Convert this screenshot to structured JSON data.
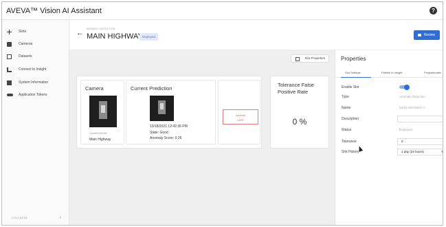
{
  "app": {
    "title": "AVEVA™ Vision AI Assistant",
    "help_icon": "?"
  },
  "sidebar": {
    "items": [
      {
        "label": "Slots",
        "icon": "plus-icon"
      },
      {
        "label": "Cameras",
        "icon": "camera-icon"
      },
      {
        "label": "Datasets",
        "icon": "dataset-icon"
      },
      {
        "label": "Connect to Insight",
        "icon": "connect-icon"
      },
      {
        "label": "System Information",
        "icon": "info-icon"
      },
      {
        "label": "Application Tokens",
        "icon": "key-icon"
      }
    ],
    "collapse_label": "COLLAPSE",
    "collapse_chevron": "‹"
  },
  "header": {
    "breadcrumb": "ANOMALY DETECTION",
    "title": "MAIN HIGHWAY V",
    "status": "Deployed",
    "review_label": "Review"
  },
  "content": {
    "slot_properties_label": "Slot Properties",
    "camera_card": {
      "title": "Camera",
      "sub_label": "CAMERA NAME",
      "name": "Main Highway"
    },
    "prediction_card": {
      "title": "Current Prediction",
      "timestamp": "10/18/2021 12:42:35 PM",
      "state": "State: Good",
      "score": "Anomaly Score: 0.26"
    },
    "drop_zone": {
      "line1": "Anomal",
      "line2": "LATE"
    },
    "tolerance_card": {
      "title": "Tolerance False Positive Rate",
      "value": "0 %"
    }
  },
  "properties": {
    "title": "Properties",
    "tabs": [
      "Slot Settings",
      "Publish to Insight",
      "Programmatic"
    ],
    "active_tab": 0,
    "fields": {
      "enable_slot_label": "Enable Slot",
      "enable_slot_on": true,
      "type_label": "Type",
      "type_value": "Anomaly Detection",
      "name_label": "Name",
      "name_value": "MAIN HIGHWAY V",
      "description_label": "Description",
      "description_value": "",
      "status_label": "Status",
      "status_value": "Deployed",
      "tolerance_label": "Tolerance",
      "tolerance_value": "0",
      "slot_history_label": "Slot History",
      "slot_history_value": "1 day (24 hours)"
    }
  },
  "colors": {
    "accent": "#2f6fd4",
    "badge_bg": "#e3e9f6",
    "alert": "#d95a5a"
  }
}
